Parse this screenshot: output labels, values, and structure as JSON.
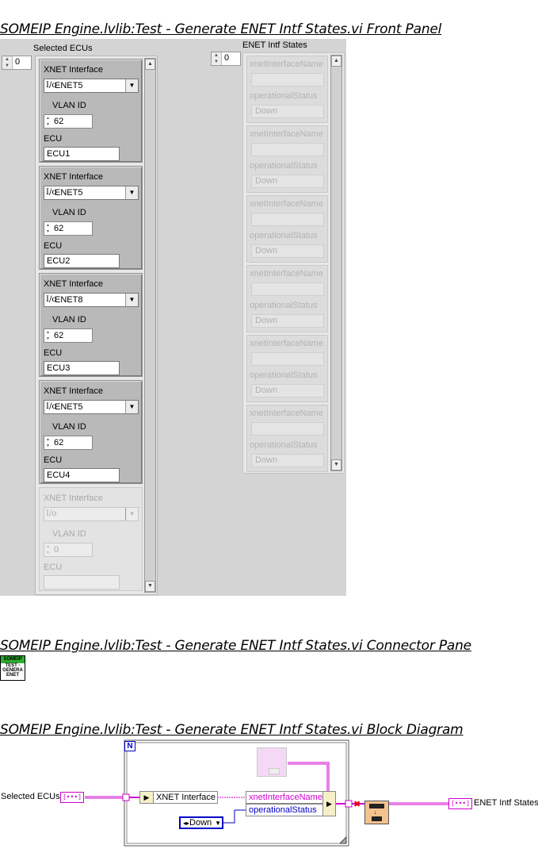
{
  "titles": {
    "front_panel": "SOMEIP Engine.lvlib:Test - Generate ENET Intf States.vi Front Panel",
    "connector_pane": "SOMEIP Engine.lvlib:Test - Generate ENET Intf States.vi Connector Pane",
    "block_diagram": "SOMEIP Engine.lvlib:Test - Generate ENET Intf States.vi Block Diagram"
  },
  "front_panel": {
    "selected_ecus": {
      "label": "Selected ECUs",
      "index": "0",
      "field_labels": {
        "interface": "XNET Interface",
        "vlan": "VLAN ID",
        "ecu": "ECU"
      },
      "elements": [
        {
          "interface": "ENET5",
          "vlan": "62",
          "ecu": "ECU1"
        },
        {
          "interface": "ENET5",
          "vlan": "62",
          "ecu": "ECU2"
        },
        {
          "interface": "ENET8",
          "vlan": "62",
          "ecu": "ECU3"
        },
        {
          "interface": "ENET5",
          "vlan": "62",
          "ecu": "ECU4"
        }
      ],
      "empty_element": {
        "interface": "",
        "vlan": "0",
        "ecu": ""
      }
    },
    "enet_states": {
      "label": "ENET Intf States",
      "index": "0",
      "field_labels": {
        "name": "xnetInterfaceName",
        "status": "operationalStatus"
      },
      "status_value": "Down",
      "element_count": 6
    }
  },
  "connector_pane": {
    "icon_header": "SOMEIP",
    "icon_lines": [
      "TEST -",
      "GENERA",
      "ENET"
    ]
  },
  "block_diagram": {
    "loop_count_terminal": "N",
    "input_terminal_label": "Selected ECUs",
    "output_terminal_label": "ENET Intf States",
    "terminal_glyph": "[•••]",
    "unbundle_field": "XNET Interface",
    "bundle_fields": [
      "xnetInterfaceName",
      "operationalStatus"
    ],
    "enum_constant": "Down",
    "colors": {
      "cluster_wire": "#d000d0",
      "enum_wire": "#0000c8",
      "error_x": "#e00000"
    }
  }
}
